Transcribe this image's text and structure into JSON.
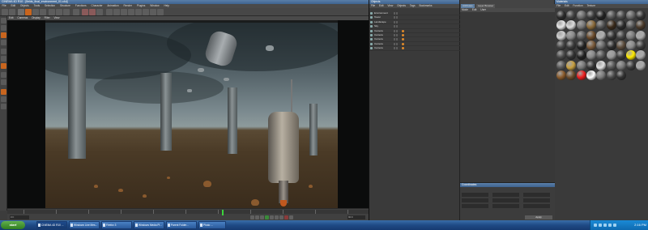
{
  "c4d": {
    "title": "CINEMA 4D R10 - [fields_final_environment_01.c4d]",
    "menu": [
      "File",
      "Edit",
      "Objects",
      "Tools",
      "Selection",
      "Structure",
      "Functions",
      "Character",
      "Animation",
      "Render",
      "Plugins",
      "Window",
      "Help"
    ],
    "viewport_menu": [
      "Edit",
      "Cameras",
      "Display",
      "Filter",
      "View"
    ],
    "timeline": {
      "start_field": "0 F",
      "end_field": "90 F"
    }
  },
  "objects": {
    "title": "Objects",
    "menu": [
      "File",
      "Edit",
      "View",
      "Objects",
      "Tags",
      "Bookmarks"
    ],
    "rows": [
      {
        "label": "Environment"
      },
      {
        "label": "Tower"
      },
      {
        "label": "Landscape"
      },
      {
        "label": "Sky"
      },
      {
        "label": "Camera"
      },
      {
        "label": "Camera"
      },
      {
        "label": "Camera"
      },
      {
        "label": "Camera"
      },
      {
        "label": "Camera"
      }
    ]
  },
  "attributes": {
    "tabs": [
      "Attributes",
      "Layer Browser"
    ],
    "menu": [
      "Mode",
      "Edit",
      "User"
    ],
    "coords_title": "Coordinates",
    "apply_label": "Apply"
  },
  "materials": {
    "title": "Materials",
    "menu": [
      "File",
      "Edit",
      "Function",
      "Texture"
    ],
    "colors": [
      "#2b2b2b",
      "#444",
      "#6a6a6a",
      "#3a3a3a",
      "#222",
      "#555",
      "#4a4a4a",
      "#666",
      "#333",
      "#e8e8e8",
      "#ddd",
      "#777",
      "#8a6a3a",
      "#555",
      "#3a2a1a",
      "#2a2a2a",
      "#555",
      "#4a3a2a",
      "#d0d0d0",
      "#8a8a8a",
      "#5a5a5a",
      "#6a4a2a",
      "#b0b0b0",
      "#333",
      "#444",
      "#7a7a7a",
      "#aaa",
      "#444",
      "#3a3a3a",
      "#222",
      "#7a5a3a",
      "#6a6a6a",
      "#2c2c2c",
      "#5a4a3a",
      "#8a8a8a",
      "#3a3a3a",
      "#4a4a4a",
      "#333",
      "#222",
      "#888",
      "#555",
      "#999",
      "#3a3a3a",
      "#ffeb00",
      "#aaaaaa",
      "#555",
      "#c8a040",
      "#777",
      "#333",
      "#e0e0e0",
      "#555",
      "#777",
      "#3a3a3a",
      "#aaa",
      "#8a5a2a",
      "#6a4a2a",
      "#ee1c1c",
      "#ffffff",
      "#7a7a7a",
      "#4a4a4a",
      "#333"
    ]
  },
  "taskbar": {
    "start_label": "start",
    "tasks": [
      {
        "label": "CINEMA 4D R10 ..."
      },
      {
        "label": "Windows Live Mes..."
      },
      {
        "label": "Firefox 3"
      },
      {
        "label": "Windows Media Pl..."
      },
      {
        "label": "Parent Folder..."
      },
      {
        "label": "Photo ..."
      }
    ],
    "clock": "2:16 PM"
  }
}
